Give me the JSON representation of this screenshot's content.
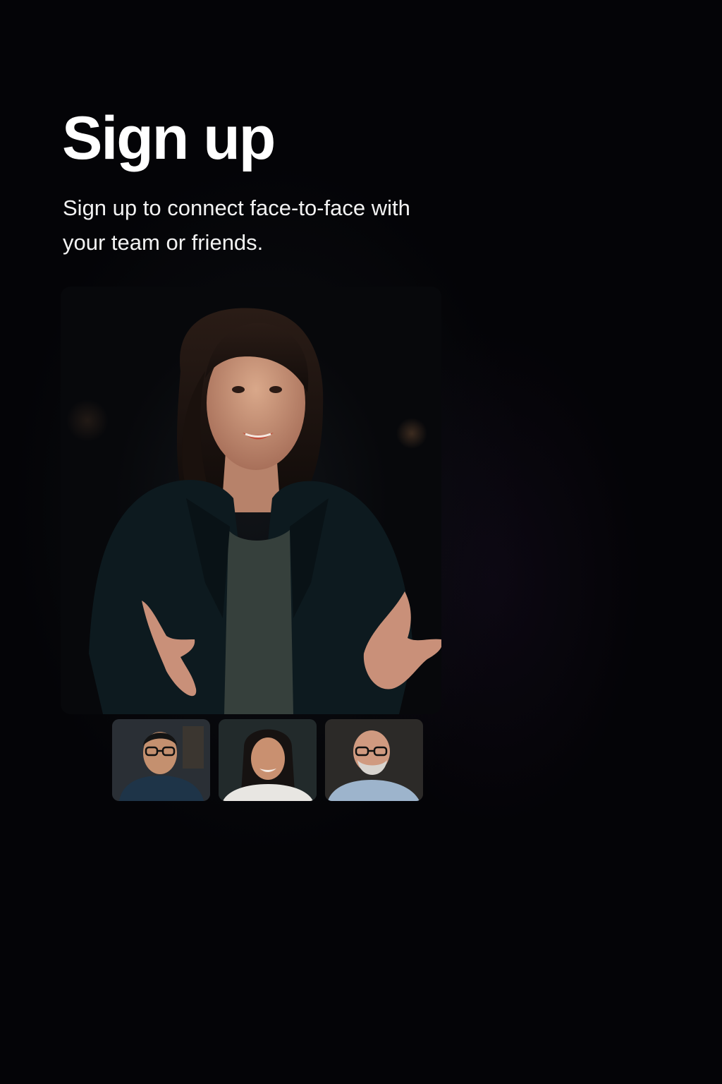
{
  "header": {
    "title": "Sign up",
    "subtitle": "Sign up to connect face-to-face with your team or friends."
  },
  "main_video": {
    "icon": "speaker-video-feed"
  },
  "participants": [
    {
      "icon": "participant-man-glasses-video"
    },
    {
      "icon": "participant-woman-video"
    },
    {
      "icon": "participant-older-man-video"
    }
  ],
  "colors": {
    "background": "#040407",
    "title": "#ffffff",
    "subtitle": "#f2f2f2"
  }
}
